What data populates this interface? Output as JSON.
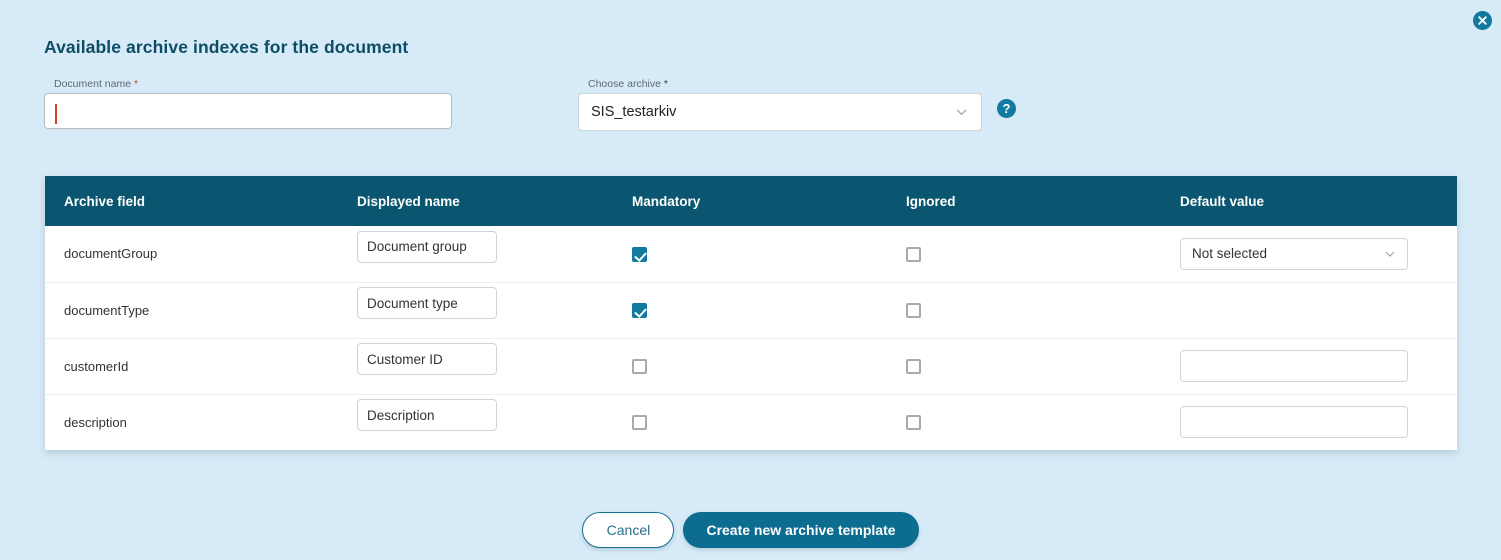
{
  "window": {
    "close_label": "×"
  },
  "header": {
    "title": "Available archive indexes for the document"
  },
  "form": {
    "document_name": {
      "label": "Document name",
      "required_mark": "*",
      "value": "",
      "placeholder": ""
    },
    "choose_archive": {
      "label": "Choose archive",
      "required_mark": "*",
      "value": "SIS_testarkiv"
    },
    "help": {
      "glyph": "?",
      "name": "help-icon"
    }
  },
  "table": {
    "columns": [
      "Archive field",
      "Displayed name",
      "Mandatory",
      "Ignored",
      "Default value"
    ],
    "rows": [
      {
        "archive_field": "documentGroup",
        "displayed_name": "Document group",
        "mandatory": true,
        "ignored": false,
        "default_kind": "select",
        "default_value": "Not selected"
      },
      {
        "archive_field": "documentType",
        "displayed_name": "Document type",
        "mandatory": true,
        "ignored": false,
        "default_kind": "none",
        "default_value": ""
      },
      {
        "archive_field": "customerId",
        "displayed_name": "Customer ID",
        "mandatory": false,
        "ignored": false,
        "default_kind": "input",
        "default_value": ""
      },
      {
        "archive_field": "description",
        "displayed_name": "Description",
        "mandatory": false,
        "ignored": false,
        "default_kind": "input",
        "default_value": ""
      }
    ]
  },
  "footer": {
    "cancel_label": "Cancel",
    "submit_label": "Create new archive template"
  },
  "colors": {
    "page_background": "#d7eaf8",
    "table_header": "#0a5570",
    "accent": "#1279a0",
    "primary_button": "#0d6d90",
    "title": "#0d4d66",
    "required_asterisk": "#d0402a"
  }
}
